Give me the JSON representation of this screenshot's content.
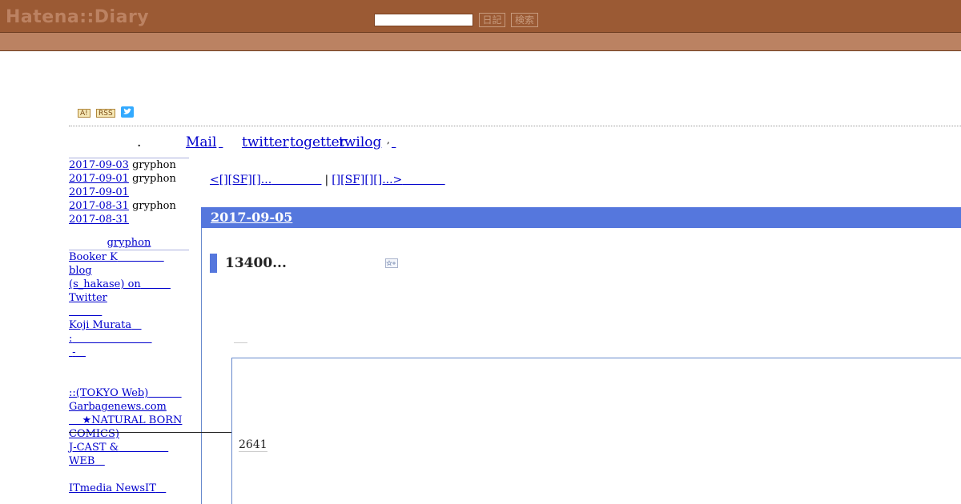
{
  "header": {
    "logo": "Hatena::Diary",
    "search_placeholder": "",
    "btn_diary": "日記",
    "btn_search": "検索"
  },
  "icons": {
    "hatena_badge": "A!",
    "rss_badge": "RSS",
    "twitter": "twitter-bird-icon"
  },
  "nav": {
    "dot": ".",
    "mail": "Mail",
    "twitter": "twitter",
    "togetter": "togetter",
    "twilog": "twilog",
    "sep": ","
  },
  "sidebar": {
    "recent_comments": [
      {
        "date": "2017-09-03",
        "user": "gryphon"
      },
      {
        "date": "2017-09-01",
        "user": "gryphon"
      },
      {
        "date": "2017-09-01",
        "user": ""
      },
      {
        "date": "2017-08-31",
        "user": "gryphon"
      },
      {
        "date": "2017-08-31",
        "user": ""
      }
    ],
    "section_head": "gryphon",
    "links_a": [
      "Booker K",
      "blog",
      "(s_hakase) on",
      "Twitter",
      "",
      "Koji Murata",
      ":",
      "-"
    ],
    "links_b": [
      "::(TOKYO Web)",
      "Garbagenews.com",
      "★NATURAL BORN",
      "COMICS)",
      "J-CAST &",
      "WEB",
      "",
      "ITmedia NewsIT"
    ]
  },
  "pager": {
    "prev": "<[][SF][]...",
    "separator": "|",
    "next": "[][SF][][]...>"
  },
  "entry": {
    "date": "2017-09-05",
    "title": "13400...",
    "embed_count": "2641"
  },
  "colors": {
    "header_bg": "#9b5a34",
    "subbar_bg": "#bb8262",
    "date_bar": "#5577dd",
    "link": "#0000cc"
  }
}
